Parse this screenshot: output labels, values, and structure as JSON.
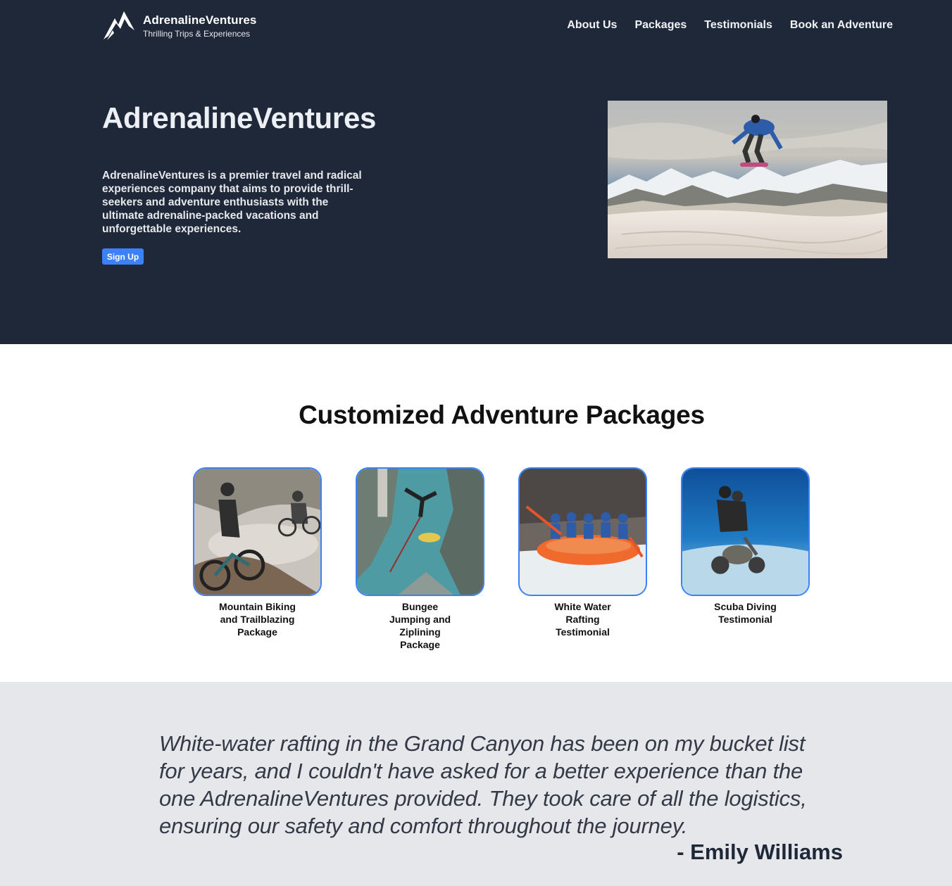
{
  "brand": {
    "name": "AdrenalineVentures",
    "tagline": "Thrilling Trips & Experiences"
  },
  "nav": {
    "items": [
      {
        "label": "About Us"
      },
      {
        "label": "Packages"
      },
      {
        "label": "Testimonials"
      },
      {
        "label": "Book an Adventure"
      }
    ]
  },
  "hero": {
    "title": "AdrenalineVentures",
    "description": "AdrenalineVentures is a premier travel and radical experiences company that aims to provide thrill-seekers and adventure enthusiasts with the ultimate adrenaline-packed vacations and unforgettable experiences.",
    "cta_label": "Sign Up",
    "image": "snowboarder-jump-mountains-photo"
  },
  "packages": {
    "title": "Customized Adventure Packages",
    "items": [
      {
        "caption": "Mountain Biking and Trailblazing Package",
        "image": "mountain-biking-photo"
      },
      {
        "caption": "Bungee Jumping and Ziplining Package",
        "image": "bungee-jumping-photo"
      },
      {
        "caption": "White Water Rafting Testimonial",
        "image": "rafting-photo"
      },
      {
        "caption": "Scuba Diving Testimonial",
        "image": "scuba-diving-photo"
      }
    ]
  },
  "testimonial": {
    "quote": "White-water rafting in the Grand Canyon has been on my bucket list for years, and I couldn't have asked for a better experience than the one AdrenalineVentures provided. They took care of all the logistics, ensuring our safety and comfort throughout the journey.",
    "author": "- Emily Williams"
  },
  "colors": {
    "hero_bg": "#1f2838",
    "accent": "#3b82f6",
    "testimonial_bg": "#e5e7eb"
  }
}
